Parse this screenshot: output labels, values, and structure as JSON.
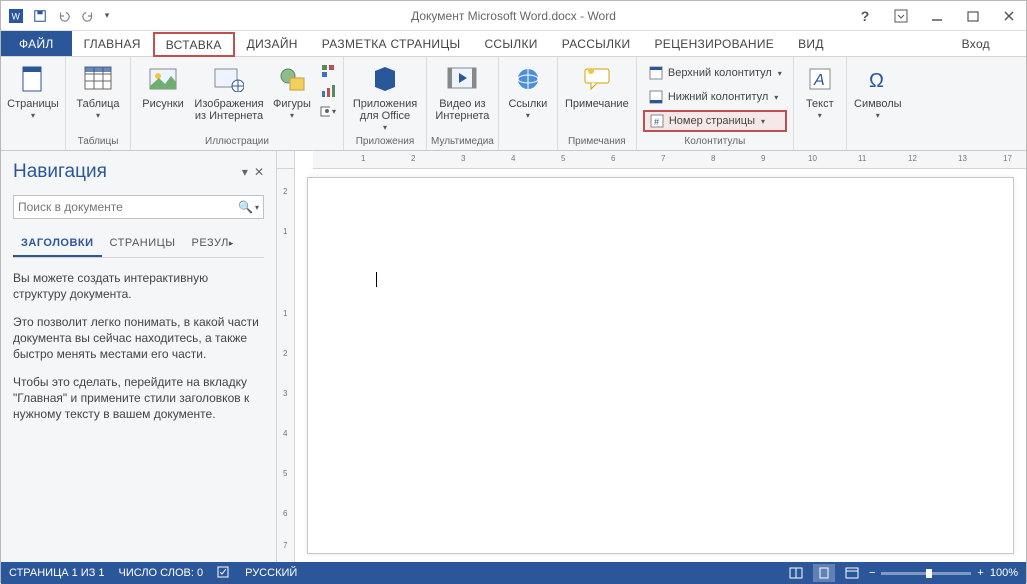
{
  "title": "Документ Microsoft Word.docx - Word",
  "signin": "Вход",
  "tabs": {
    "file": "ФАЙЛ",
    "home": "ГЛАВНАЯ",
    "insert": "ВСТАВКА",
    "design": "ДИЗАЙН",
    "layout": "РАЗМЕТКА СТРАНИЦЫ",
    "references": "ССЫЛКИ",
    "mailings": "РАССЫЛКИ",
    "review": "РЕЦЕНЗИРОВАНИЕ",
    "view": "ВИД"
  },
  "groups": {
    "pages": {
      "btn": "Страницы",
      "label": ""
    },
    "tables": {
      "btn": "Таблица",
      "label": "Таблицы"
    },
    "illustrations": {
      "pictures": "Рисунки",
      "online": "Изображения из Интернета",
      "shapes": "Фигуры",
      "label": "Иллюстрации"
    },
    "apps": {
      "btn": "Приложения для Office",
      "label": "Приложения"
    },
    "media": {
      "btn": "Видео из Интернета",
      "label": "Мультимедиа"
    },
    "links": {
      "btn": "Ссылки",
      "label": ""
    },
    "comments": {
      "btn": "Примечание",
      "label": "Примечания"
    },
    "headerfooter": {
      "header": "Верхний колонтитул",
      "footer": "Нижний колонтитул",
      "pagenum": "Номер страницы",
      "label": "Колонтитулы"
    },
    "text": {
      "btn": "Текст",
      "label": ""
    },
    "symbols": {
      "btn": "Символы",
      "label": ""
    }
  },
  "nav": {
    "title": "Навигация",
    "search_placeholder": "Поиск в документе",
    "tabs": {
      "headings": "ЗАГОЛОВКИ",
      "pages": "СТРАНИЦЫ",
      "results": "РЕЗУЛ"
    },
    "p1": "Вы можете создать интерактивную структуру документа.",
    "p2": "Это позволит легко понимать, в какой части документа вы сейчас находитесь, а также быстро менять местами его части.",
    "p3": "Чтобы это сделать, перейдите на вкладку \"Главная\" и примените стили заголовков к нужному тексту в вашем документе."
  },
  "status": {
    "page": "СТРАНИЦА 1 ИЗ 1",
    "words": "ЧИСЛО СЛОВ: 0",
    "lang": "РУССКИЙ",
    "zoom": "100%"
  }
}
